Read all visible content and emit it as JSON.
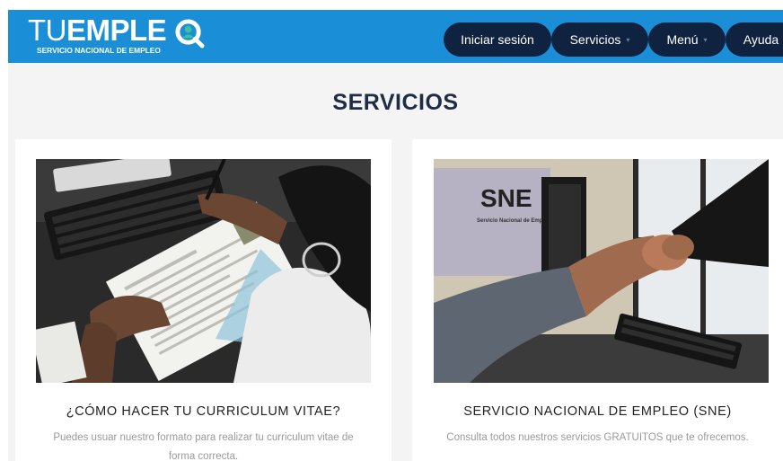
{
  "header": {
    "logo": {
      "text_main": "TUEMPLEO",
      "text_sub": "SERVICIO NACIONAL DE EMPLEO"
    },
    "nav": [
      {
        "label": "Iniciar sesión",
        "has_caret": false
      },
      {
        "label": "Servicios",
        "has_caret": true
      },
      {
        "label": "Menú",
        "has_caret": true
      },
      {
        "label": "Ayuda",
        "has_caret": false
      }
    ],
    "caret_glyph": "▾"
  },
  "section": {
    "title": "SERVICIOS",
    "cards": [
      {
        "title": "¿CÓMO HACER TU CURRICULUM VITAE?",
        "description": "Puedes usuar nuestro formato para realizar tu curriculum vitae de forma correcta."
      },
      {
        "title": "SERVICIO NACIONAL DE EMPLEO (SNE)",
        "description": "Consulta todos nuestros servicios GRATUITOS que te ofrecemos.",
        "photo_sign_text": "SNE",
        "photo_sign_sub": "Servicio Nacional de Empleo"
      }
    ]
  },
  "colors": {
    "header_bg": "#1a8ed6",
    "nav_bg": "#0f2340",
    "title": "#1e2c47",
    "section_bg": "#f4f4f4",
    "logo_accent": "#3fbfa0"
  }
}
